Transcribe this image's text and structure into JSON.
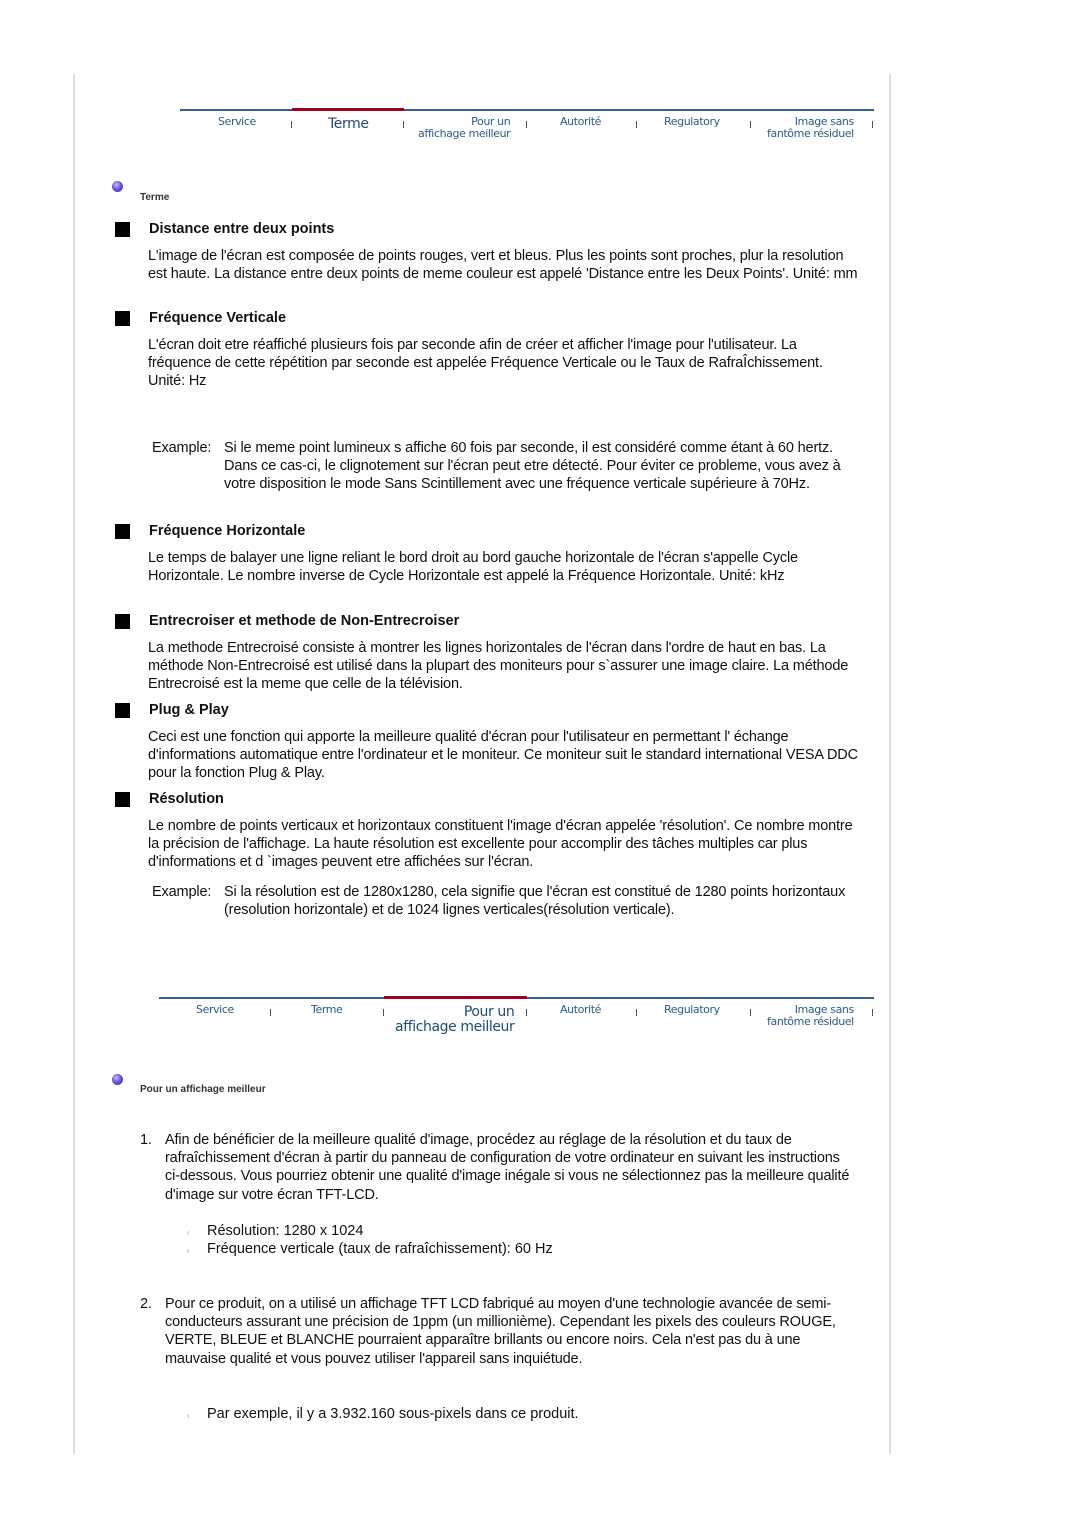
{
  "nav": {
    "items": [
      {
        "label_line1": "Service",
        "label_line2": ""
      },
      {
        "label_line1": "Terme",
        "label_line2": ""
      },
      {
        "label_line1": "Pour un",
        "label_line2": "affichage meilleur"
      },
      {
        "label_line1": "Autorité",
        "label_line2": ""
      },
      {
        "label_line1": "Regulatory",
        "label_line2": ""
      },
      {
        "label_line1": "Image sans",
        "label_line2": "fantôme résiduel"
      }
    ],
    "active_color": "#a00020",
    "line_color": "#3a5d94",
    "top_active": "Terme",
    "bottom_active": "Pour un affichage meilleur"
  },
  "section1": {
    "label": "Terme",
    "terms": [
      {
        "title": "Distance entre deux points",
        "text": "L'image de l'écran est composée de points rouges, vert et bleus. Plus les points sont proches, plur la resolution est haute. La distance entre deux points de meme couleur est appelé 'Distance entre les Deux Points'. Unité: mm"
      },
      {
        "title": "Fréquence Verticale",
        "text": "L'écran doit etre réaffiché plusieurs fois par seconde afin de créer et afficher l'image pour l'utilisateur. La fréquence de cette répétition par seconde est appelée Fréquence Verticale ou le Taux de RafraÎchissement. Unité: Hz",
        "example_label": "Example:",
        "example_text": "Si le meme point lumineux s affiche 60 fois par seconde, il est considéré comme étant à 60 hertz. Dans ce cas-ci, le clignotement sur l'écran peut etre détecté. Pour éviter ce probleme, vous avez à votre disposition le mode Sans Scintillement avec une fréquence verticale supérieure à 70Hz."
      },
      {
        "title": "Fréquence Horizontale",
        "text": "Le temps de balayer une ligne reliant le bord droit au bord gauche horizontale de l'écran s'appelle Cycle Horizontale. Le nombre inverse de Cycle Horizontale est appelé la Fréquence Horizontale. Unité: kHz"
      },
      {
        "title": "Entrecroiser et methode de Non-Entrecroiser",
        "text": "La methode Entrecroisé consiste à montrer les lignes horizontales de l'écran dans l'ordre de haut en bas. La méthode Non-Entrecroisé est utilisé dans la plupart des moniteurs pour s`assurer une image claire. La méthode Entrecroisé est la meme que celle de la télévision."
      },
      {
        "title": "Plug & Play",
        "text": "Ceci est une fonction qui apporte la meilleure qualité d'écran pour l'utilisateur en permettant l' échange d'informations automatique entre l'ordinateur et le moniteur. Ce moniteur suit le standard international VESA DDC pour la fonction Plug & Play."
      },
      {
        "title": "Résolution",
        "text": "Le nombre de points verticaux et horizontaux constituent l'image d'écran appelée 'résolution'. Ce nombre montre la précision de l'affichage. La haute résolution est excellente pour accomplir des tâches multiples car plus d'informations et d `images peuvent etre affichées sur l'écran.",
        "example_label": "Example:",
        "example_text": "Si la résolution est de 1280x1280, cela signifie que l'écran est constitué de 1280 points horizontaux (resolution horizontale) et de 1024 lignes verticales(résolution verticale)."
      }
    ]
  },
  "section2": {
    "label": "Pour un affichage meilleur",
    "items": [
      {
        "num": "1.",
        "text": "Afin de bénéficier de la meilleure qualité d'image, procédez au réglage de la résolution et du taux de rafraîchissement d'écran à partir du panneau de configuration de votre ordinateur en suivant les instructions ci-dessous. Vous pourriez obtenir une qualité d'image inégale si vous ne sélectionnez pas la meilleure qualité d'image sur votre écran TFT-LCD.",
        "subitems": [
          "Résolution: 1280 x 1024",
          "Fréquence verticale (taux de rafraîchissement): 60 Hz"
        ]
      },
      {
        "num": "2.",
        "text": "Pour ce produit, on a utilisé un affichage TFT LCD fabriqué au moyen d'une technologie avancée de semi-conducteurs assurant une précision de 1ppm (un millionième). Cependant les pixels des couleurs ROUGE, VERTE, BLEUE et BLANCHE pourraient apparaître brillants ou encore noirs. Cela n'est pas du à une mauvaise qualité et vous pouvez utiliser l'appareil sans inquiétude.",
        "subitems": [
          "Par exemple, il y a 3.932.160 sous-pixels dans ce produit."
        ]
      }
    ]
  }
}
